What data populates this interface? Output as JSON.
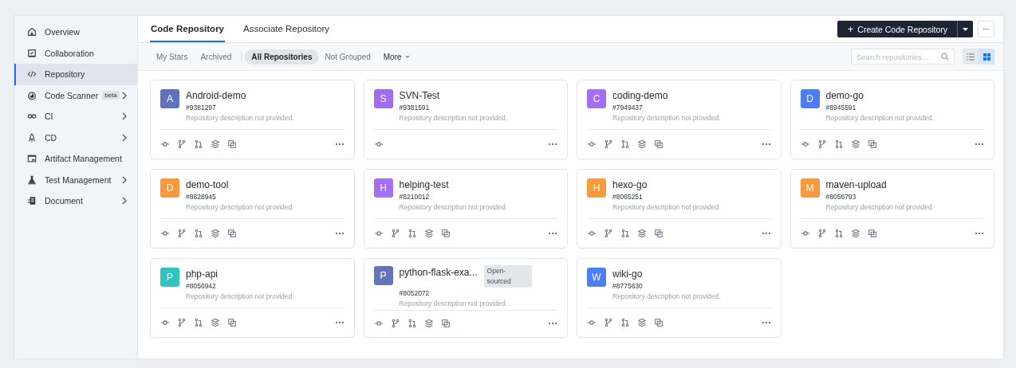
{
  "sidebar": {
    "items": [
      {
        "label": "Overview",
        "selected": false,
        "expandable": false
      },
      {
        "label": "Collaboration",
        "selected": false,
        "expandable": false
      },
      {
        "label": "Repository",
        "selected": true,
        "expandable": false
      },
      {
        "label": "Code Scanner",
        "badge": "beta",
        "selected": false,
        "expandable": true
      },
      {
        "label": "CI",
        "selected": false,
        "expandable": true
      },
      {
        "label": "CD",
        "selected": false,
        "expandable": true
      },
      {
        "label": "Artifact Management",
        "selected": false,
        "expandable": false
      },
      {
        "label": "Test Management",
        "selected": false,
        "expandable": true
      },
      {
        "label": "Document",
        "selected": false,
        "expandable": true
      }
    ]
  },
  "tabs": [
    {
      "label": "Code Repository",
      "selected": true
    },
    {
      "label": "Associate Repository",
      "selected": false
    }
  ],
  "create_button": {
    "label": "Create Code Repository",
    "icon": "+"
  },
  "filters": {
    "left": [
      {
        "label": "My Stars",
        "selected": false
      },
      {
        "label": "Archived",
        "selected": false
      }
    ],
    "groups": [
      {
        "label": "All Repositories",
        "selected": true
      },
      {
        "label": "Not Grouped",
        "selected": false
      }
    ],
    "more": "More"
  },
  "search": {
    "placeholder": "Search repositories..."
  },
  "view_mode": {
    "list_selected": false,
    "grid_selected": true
  },
  "repositories": [
    {
      "initial": "A",
      "color": "#5f73ba",
      "name": "Android-demo",
      "id": "#9381297",
      "description": "Repository description not provided.",
      "kind": "git"
    },
    {
      "initial": "S",
      "color": "#a06cf0",
      "name": "SVN-Test",
      "id": "#9381591",
      "description": "Repository description not provided.",
      "kind": "svn"
    },
    {
      "initial": "C",
      "color": "#a56ef0",
      "name": "coding-demo",
      "id": "#7949437",
      "description": "Repository description not provided.",
      "kind": "git"
    },
    {
      "initial": "D",
      "color": "#4d7df2",
      "name": "demo-go",
      "id": "#8945591",
      "description": "Repository description not provided.",
      "kind": "git"
    },
    {
      "initial": "D",
      "color": "#f6983c",
      "name": "demo-tool",
      "id": "#8828945",
      "description": "Repository description not provided.",
      "kind": "git"
    },
    {
      "initial": "H",
      "color": "#a470f1",
      "name": "helping-test",
      "id": "#8210012",
      "description": "Repository description not provided.",
      "kind": "git"
    },
    {
      "initial": "H",
      "color": "#f69a3e",
      "name": "hexo-go",
      "id": "#8065251",
      "description": "Repository description not provided.",
      "kind": "git"
    },
    {
      "initial": "M",
      "color": "#f7993d",
      "name": "maven-upload",
      "id": "#8056793",
      "description": "Repository description not provided.",
      "kind": "git"
    },
    {
      "initial": "P",
      "color": "#2ec4c0",
      "name": "php-api",
      "id": "#8056942",
      "description": "Repository description not provided.",
      "kind": "git"
    },
    {
      "initial": "P",
      "color": "#6175b9",
      "name": "python-flask-exa...",
      "badge": "Open-sourced",
      "id": "#8052072",
      "description": "Repository description not provided.",
      "kind": "git"
    },
    {
      "initial": "W",
      "color": "#4e7ef3",
      "name": "wiki-go",
      "id": "#8775630",
      "description": "Repository description not provided.",
      "kind": "git"
    }
  ]
}
